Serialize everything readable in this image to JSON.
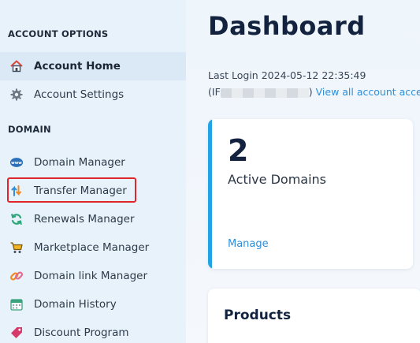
{
  "sidebar": {
    "account_section": "ACCOUNT OPTIONS",
    "account_items": [
      {
        "label": "Account Home",
        "icon": "home-icon",
        "active": true
      },
      {
        "label": "Account Settings",
        "icon": "gear-icon"
      }
    ],
    "domain_section": "DOMAIN",
    "domain_items": [
      {
        "label": "Domain Manager",
        "icon": "www-globe-icon"
      },
      {
        "label": "Transfer Manager",
        "icon": "transfer-arrows-icon",
        "highlighted": true
      },
      {
        "label": "Renewals Manager",
        "icon": "refresh-icon"
      },
      {
        "label": "Marketplace Manager",
        "icon": "shopping-cart-icon"
      },
      {
        "label": "Domain link Manager",
        "icon": "link-icon"
      },
      {
        "label": "Domain History",
        "icon": "calendar-icon"
      },
      {
        "label": "Discount Program",
        "icon": "tag-icon"
      }
    ]
  },
  "main": {
    "title": "Dashboard",
    "last_login": "Last Login 2024-05-12 22:35:49",
    "ip_open": "(IF",
    "ip_close": ")",
    "view_all_link": "View all account acces",
    "active_card": {
      "count": "2",
      "label": "Active Domains",
      "link": "Manage"
    },
    "products_card": {
      "title": "Products"
    }
  },
  "colors": {
    "sidebar_bg": "#e8f2fa",
    "active_bg": "#dbe9f6",
    "accent_blue": "#20a4e6",
    "link_blue": "#2e8fd8",
    "highlight_red": "#e0262b",
    "title_navy": "#13233f"
  }
}
